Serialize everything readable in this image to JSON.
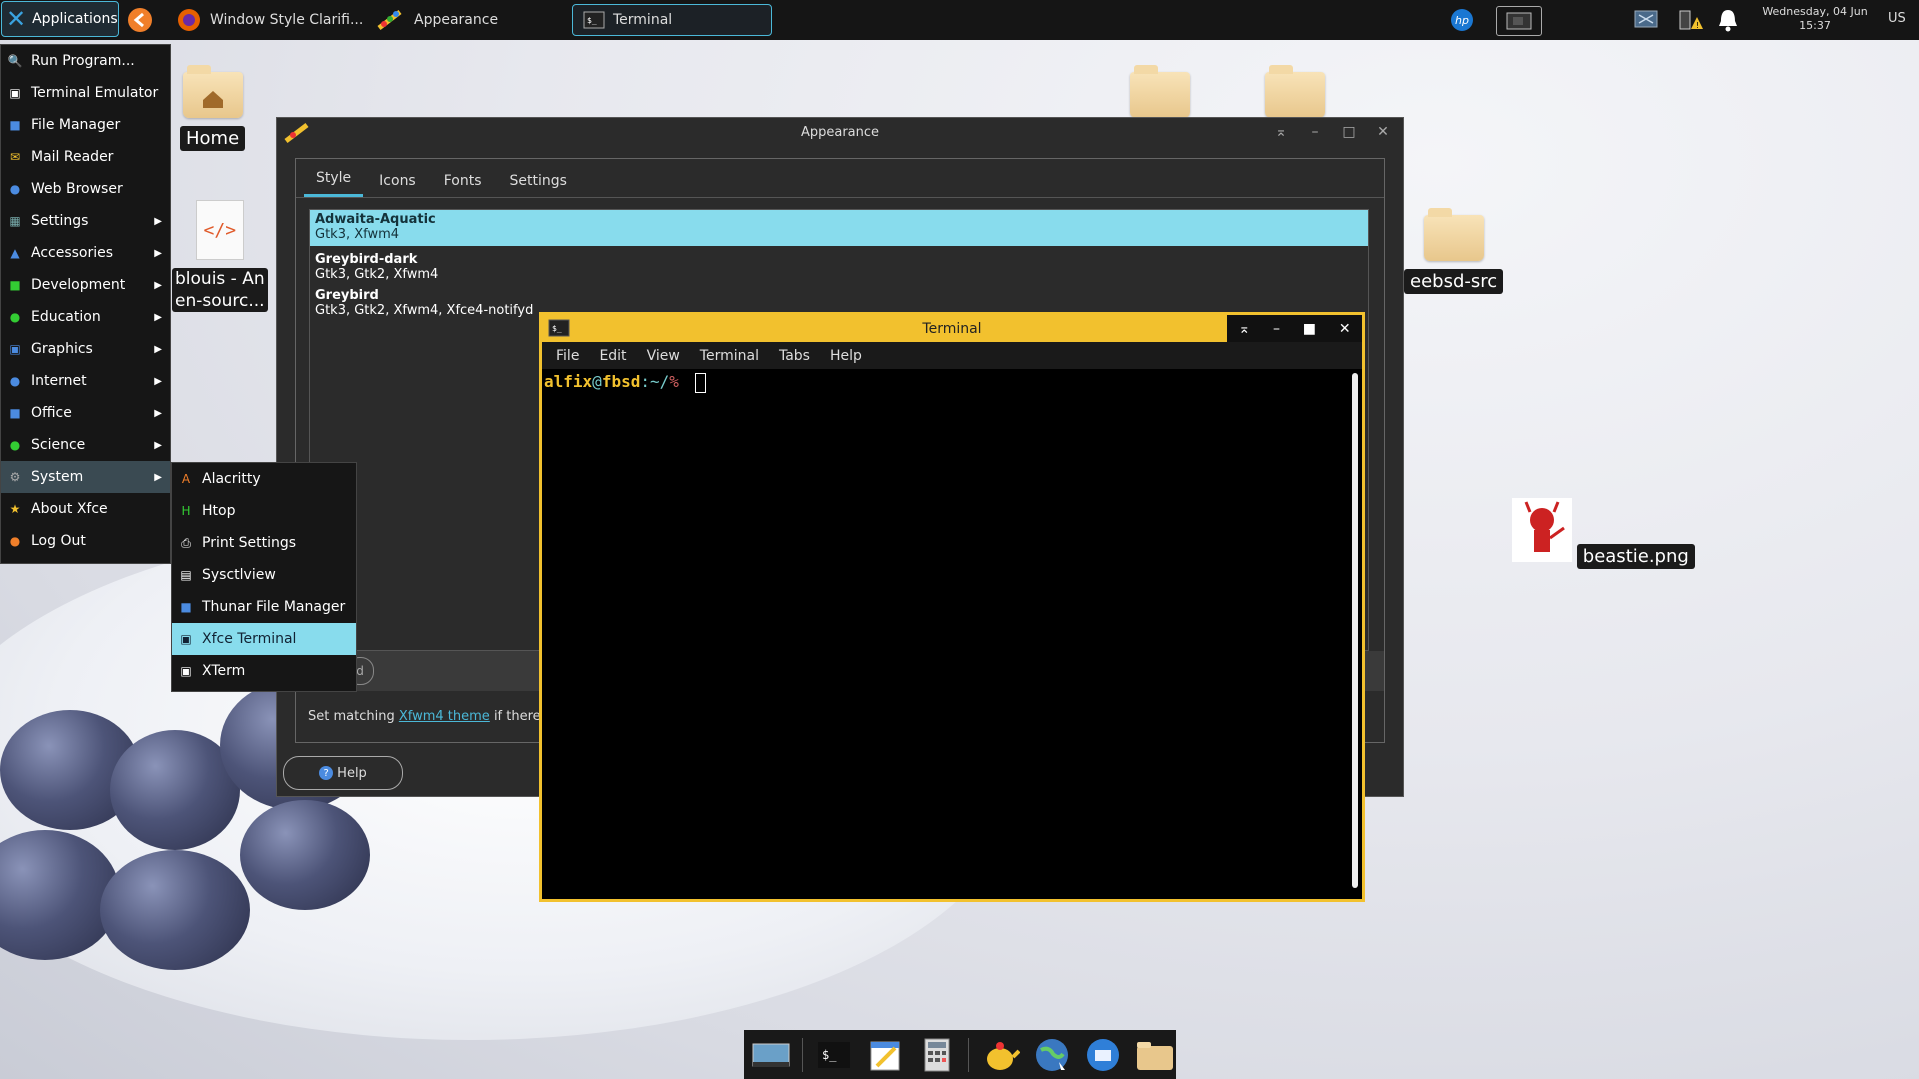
{
  "panel": {
    "apps_label": "Applications",
    "tasks": [
      "Window Style Clarifi...",
      "Appearance",
      "Terminal"
    ],
    "clock_line1": "Wednesday, 04 Jun",
    "clock_line2": "15:37",
    "keyboard": "US"
  },
  "desktop": {
    "home": "Home",
    "blouis_l1": "blouis - An",
    "blouis_l2": "en-sourc...",
    "freebsd": "eebsd-src",
    "beastie": "beastie.png"
  },
  "appearance": {
    "title": "Appearance",
    "tabs": [
      "Style",
      "Icons",
      "Fonts",
      "Settings"
    ],
    "themes": [
      {
        "name": "Adwaita-Aquatic",
        "desc": "Gtk3, Xfwm4"
      },
      {
        "name": "Greybird-dark",
        "desc": "Gtk3, Gtk2, Xfwm4"
      },
      {
        "name": "Greybird",
        "desc": "Gtk3, Gtk2, Xfwm4, Xfce4-notifyd"
      }
    ],
    "bottom_text_pre": "Set matching",
    "bottom_link": "Xfwm4 theme",
    "bottom_text_post": "if there",
    "help": "Help",
    "partial_btn": "d"
  },
  "terminal": {
    "title": "Terminal",
    "menu": [
      "File",
      "Edit",
      "View",
      "Terminal",
      "Tabs",
      "Help"
    ],
    "prompt_user": "alfix",
    "prompt_at": "@",
    "prompt_host": "fbsd",
    "prompt_path": ":~/",
    "prompt_end": "%"
  },
  "app_menu": [
    {
      "label": "Run Program..."
    },
    {
      "label": "Terminal Emulator"
    },
    {
      "label": "File Manager"
    },
    {
      "label": "Mail Reader"
    },
    {
      "label": "Web Browser"
    },
    {
      "label": "Settings"
    },
    {
      "label": "Accessories"
    },
    {
      "label": "Development"
    },
    {
      "label": "Education"
    },
    {
      "label": "Graphics"
    },
    {
      "label": "Internet"
    },
    {
      "label": "Office"
    },
    {
      "label": "Science"
    },
    {
      "label": "System"
    },
    {
      "label": "About Xfce"
    },
    {
      "label": "Log Out"
    }
  ],
  "system_menu": [
    {
      "label": "Alacritty"
    },
    {
      "label": "Htop"
    },
    {
      "label": "Print Settings"
    },
    {
      "label": "Sysctlview"
    },
    {
      "label": "Thunar File Manager"
    },
    {
      "label": "Xfce Terminal"
    },
    {
      "label": "XTerm"
    }
  ],
  "colors": {
    "accent": "#88dced",
    "terminal_border": "#f2c12e"
  }
}
